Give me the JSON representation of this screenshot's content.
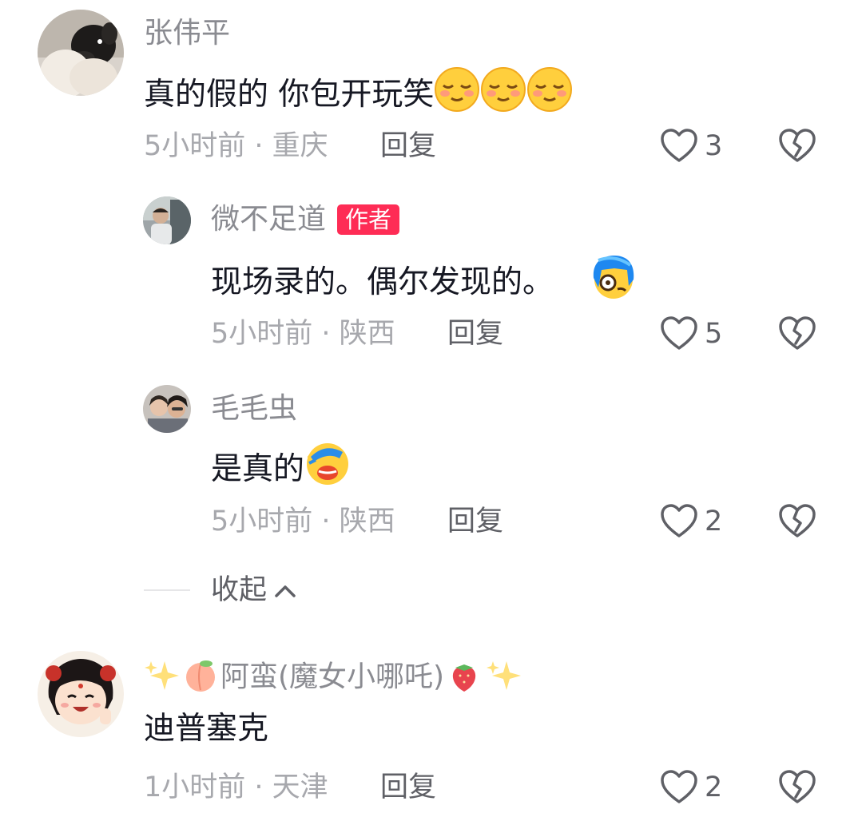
{
  "comments": [
    {
      "username": "张伟平",
      "text": "真的假的 你包开玩笑",
      "emojis": [
        "relieved-face",
        "relieved-face",
        "relieved-face"
      ],
      "time_location": "5小时前 · 重庆",
      "reply": "回复",
      "likes": "3"
    },
    {
      "username": "微不足道",
      "badge": "作者",
      "text": "现场录的。偶尔发现的。",
      "emojis": [
        "blue-hair-monocle-face"
      ],
      "time_location": "5小时前 · 陕西",
      "reply": "回复",
      "likes": "5"
    },
    {
      "username": "毛毛虫",
      "text": "是真的",
      "emojis": [
        "face-palm-crying"
      ],
      "time_location": "5小时前 · 陕西",
      "reply": "回复",
      "likes": "2"
    },
    {
      "username": "阿蛮(魔女小哪吒)",
      "username_decorations": [
        "sparkles",
        "peach",
        "strawberry",
        "sparkles"
      ],
      "text": "迪普塞克",
      "time_location": "1小时前 · 天津",
      "reply": "回复",
      "likes": "2"
    }
  ],
  "collapse_label": "收起",
  "colors": {
    "badge": "#fe2c55",
    "meta": "#a7a8ad",
    "username": "#8a8b91"
  }
}
